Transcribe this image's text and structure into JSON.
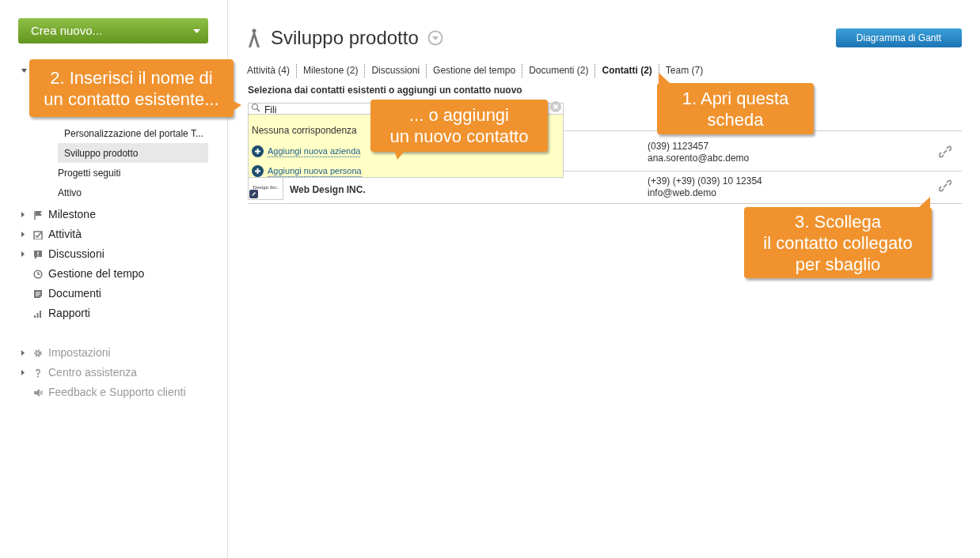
{
  "sidebar": {
    "create_button": "Crea nuovo...",
    "tree": [
      {
        "label": "Personalizzazione del portale T...",
        "selected": false,
        "indent": true
      },
      {
        "label": "Sviluppo prodotto",
        "selected": true,
        "indent": true
      },
      {
        "label": "Progetti seguiti",
        "selected": false,
        "indent": false
      },
      {
        "label": "Attivo",
        "selected": false,
        "indent": false
      }
    ],
    "nav": [
      {
        "label": "Milestone",
        "expandable": true,
        "disabled": false
      },
      {
        "label": "Attività",
        "expandable": true,
        "disabled": false
      },
      {
        "label": "Discussioni",
        "expandable": true,
        "disabled": false
      },
      {
        "label": "Gestione del tempo",
        "expandable": false,
        "disabled": false
      },
      {
        "label": "Documenti",
        "expandable": false,
        "disabled": false
      },
      {
        "label": "Rapporti",
        "expandable": false,
        "disabled": false
      }
    ],
    "footer_nav": [
      {
        "label": "Impostazioni",
        "expandable": true,
        "disabled": true
      },
      {
        "label": "Centro assistenza",
        "expandable": true,
        "disabled": true
      },
      {
        "label": "Feedback e Supporto clienti",
        "expandable": false,
        "disabled": true
      }
    ]
  },
  "header": {
    "title": "Sviluppo prodotto",
    "gantt_button": "Diagramma di Gantt"
  },
  "tabs": [
    {
      "label": "Attività (4)",
      "selected": false
    },
    {
      "label": "Milestone (2)",
      "selected": false
    },
    {
      "label": "Discussioni",
      "selected": false
    },
    {
      "label": "Gestione del tempo",
      "selected": false
    },
    {
      "label": "Documenti (2)",
      "selected": false
    },
    {
      "label": "Contatti (2)",
      "selected": true
    },
    {
      "label": "Team (7)",
      "selected": false
    }
  ],
  "contact_picker": {
    "label": "Seleziona dai contatti esistenti o aggiungi un contatto nuovo",
    "value": "Fili",
    "no_match": "Nessuna corrispondenza",
    "actions": [
      "Aggiungi nuova azienda",
      "Aggiungi nuova persona"
    ]
  },
  "contacts": [
    {
      "phone": "(039) 1123457",
      "email": "ana.sorento@abc.demo"
    },
    {
      "name": "Web Design INC.",
      "logo_text": "Design Inc.",
      "phone": "(+39) (+39) (039) 10 12354",
      "email": "info@web.demo"
    }
  ],
  "callouts": [
    "2. Inserisci il nome di\nun contatto esistente...",
    "... o aggiungi\nun nuovo contatto",
    "1. Apri questa\nscheda",
    "3. Scollega\nil contatto collegato\nper sbaglio"
  ]
}
